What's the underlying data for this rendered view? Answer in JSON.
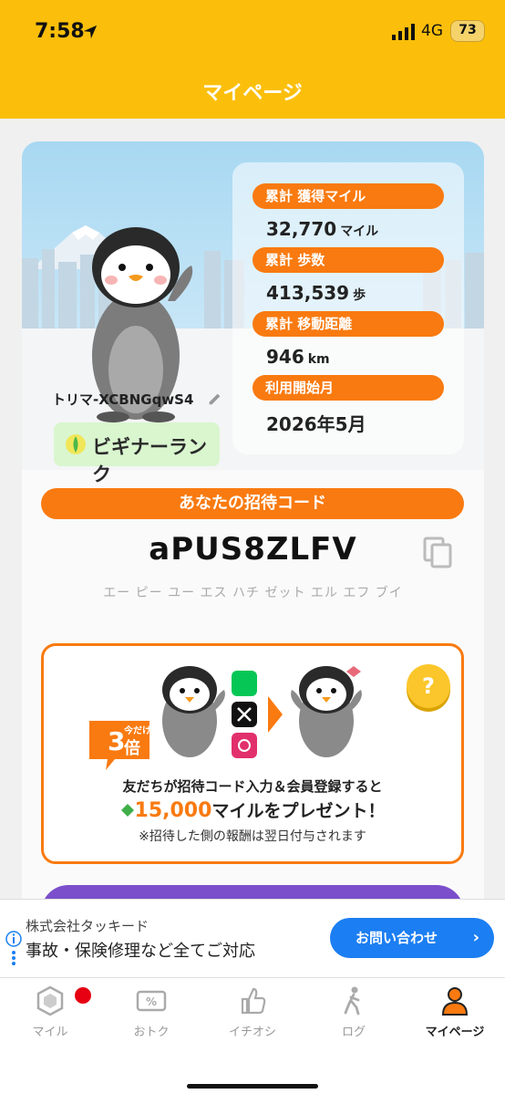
{
  "status": {
    "time": "7:58",
    "network": "4G",
    "battery": "73"
  },
  "header": {
    "title": "マイページ"
  },
  "profile": {
    "username": "トリマ-XCBNGqwS4",
    "rank": "ビギナーランク"
  },
  "stats": [
    {
      "label": "累計 獲得マイル",
      "value": "32,770",
      "unit": "マイル"
    },
    {
      "label": "累計 歩数",
      "value": "413,539",
      "unit": "歩"
    },
    {
      "label": "累計 移動距離",
      "value": "946",
      "unit": "km"
    },
    {
      "label": "利用開始月",
      "value": "2026年5月",
      "unit": ""
    }
  ],
  "invite": {
    "title": "あなたの招待コード",
    "code": "aPUS8ZLFV",
    "reading": "エー ピー ユー エス ハチ ゼット エル エフ ブイ"
  },
  "promo": {
    "badge_small": "今だけ",
    "badge_big": "3",
    "badge_unit": "倍",
    "line1": "友だちが招待コード入力＆会員登録すると",
    "amount": "15,000",
    "line2_rest": "マイルをプレゼント！",
    "line3": "※招待した側の報酬は翌日付与されます",
    "help": "?",
    "social": [
      "LINE",
      "X",
      "Instagram"
    ]
  },
  "ad": {
    "company": "株式会社タッキード",
    "headline": "事故・保険修理など全てご対応",
    "button": "お問い合わせ",
    "chevron": "›"
  },
  "tabs": [
    {
      "label": "マイル",
      "icon": "mile-hex-icon"
    },
    {
      "label": "おトク",
      "icon": "coupon-icon"
    },
    {
      "label": "イチオシ",
      "icon": "thumbs-up-icon"
    },
    {
      "label": "ログ",
      "icon": "walker-icon"
    },
    {
      "label": "マイページ",
      "icon": "person-icon"
    }
  ],
  "colors": {
    "header": "#FBBF0B",
    "accent": "#F97A10",
    "adButton": "#1B7EF2",
    "rank": "#D9F6CF"
  }
}
